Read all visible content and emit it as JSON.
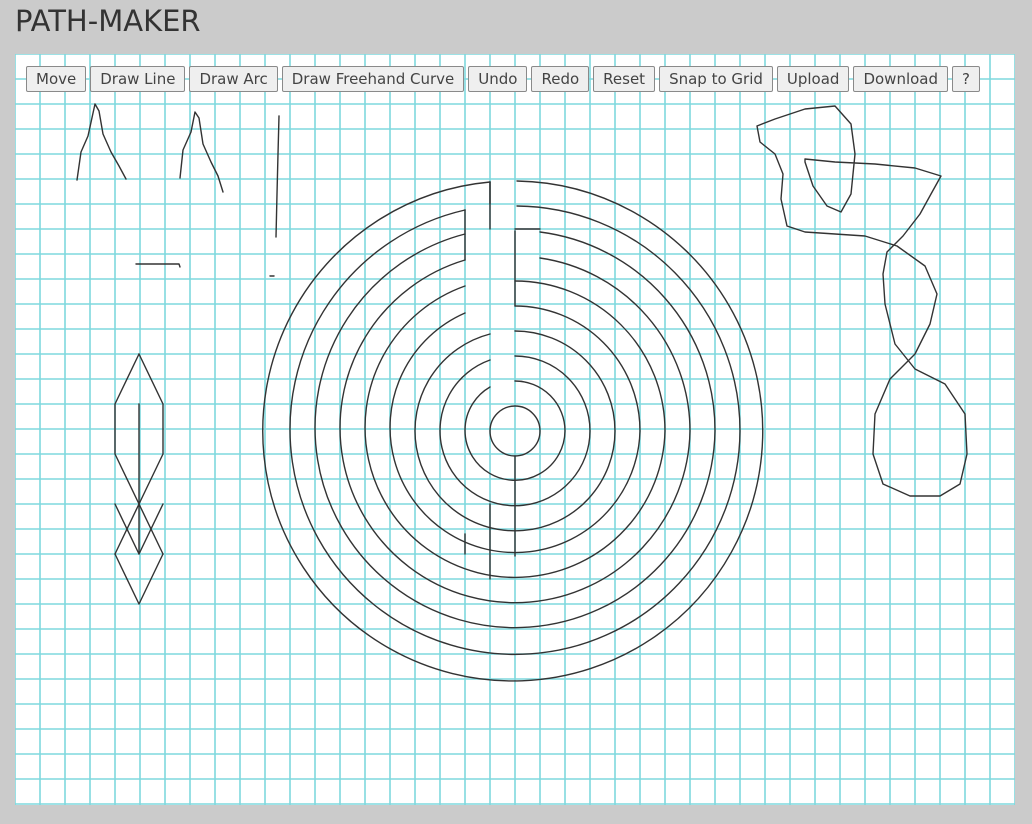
{
  "app": {
    "title": "PATH-MAKER"
  },
  "toolbar": {
    "buttons": [
      {
        "id": "move",
        "label": "Move"
      },
      {
        "id": "draw-line",
        "label": "Draw Line"
      },
      {
        "id": "draw-arc",
        "label": "Draw Arc"
      },
      {
        "id": "draw-freehand",
        "label": "Draw Freehand Curve"
      },
      {
        "id": "undo",
        "label": "Undo"
      },
      {
        "id": "redo",
        "label": "Redo"
      },
      {
        "id": "reset",
        "label": "Reset"
      },
      {
        "id": "snap",
        "label": "Snap to Grid"
      },
      {
        "id": "upload",
        "label": "Upload"
      },
      {
        "id": "download",
        "label": "Download"
      },
      {
        "id": "help",
        "label": "?"
      }
    ]
  },
  "colors": {
    "page_background": "#cbcbcb",
    "canvas_background": "#ffffff",
    "grid_line": "#7fd8de",
    "stroke": "#333333"
  }
}
